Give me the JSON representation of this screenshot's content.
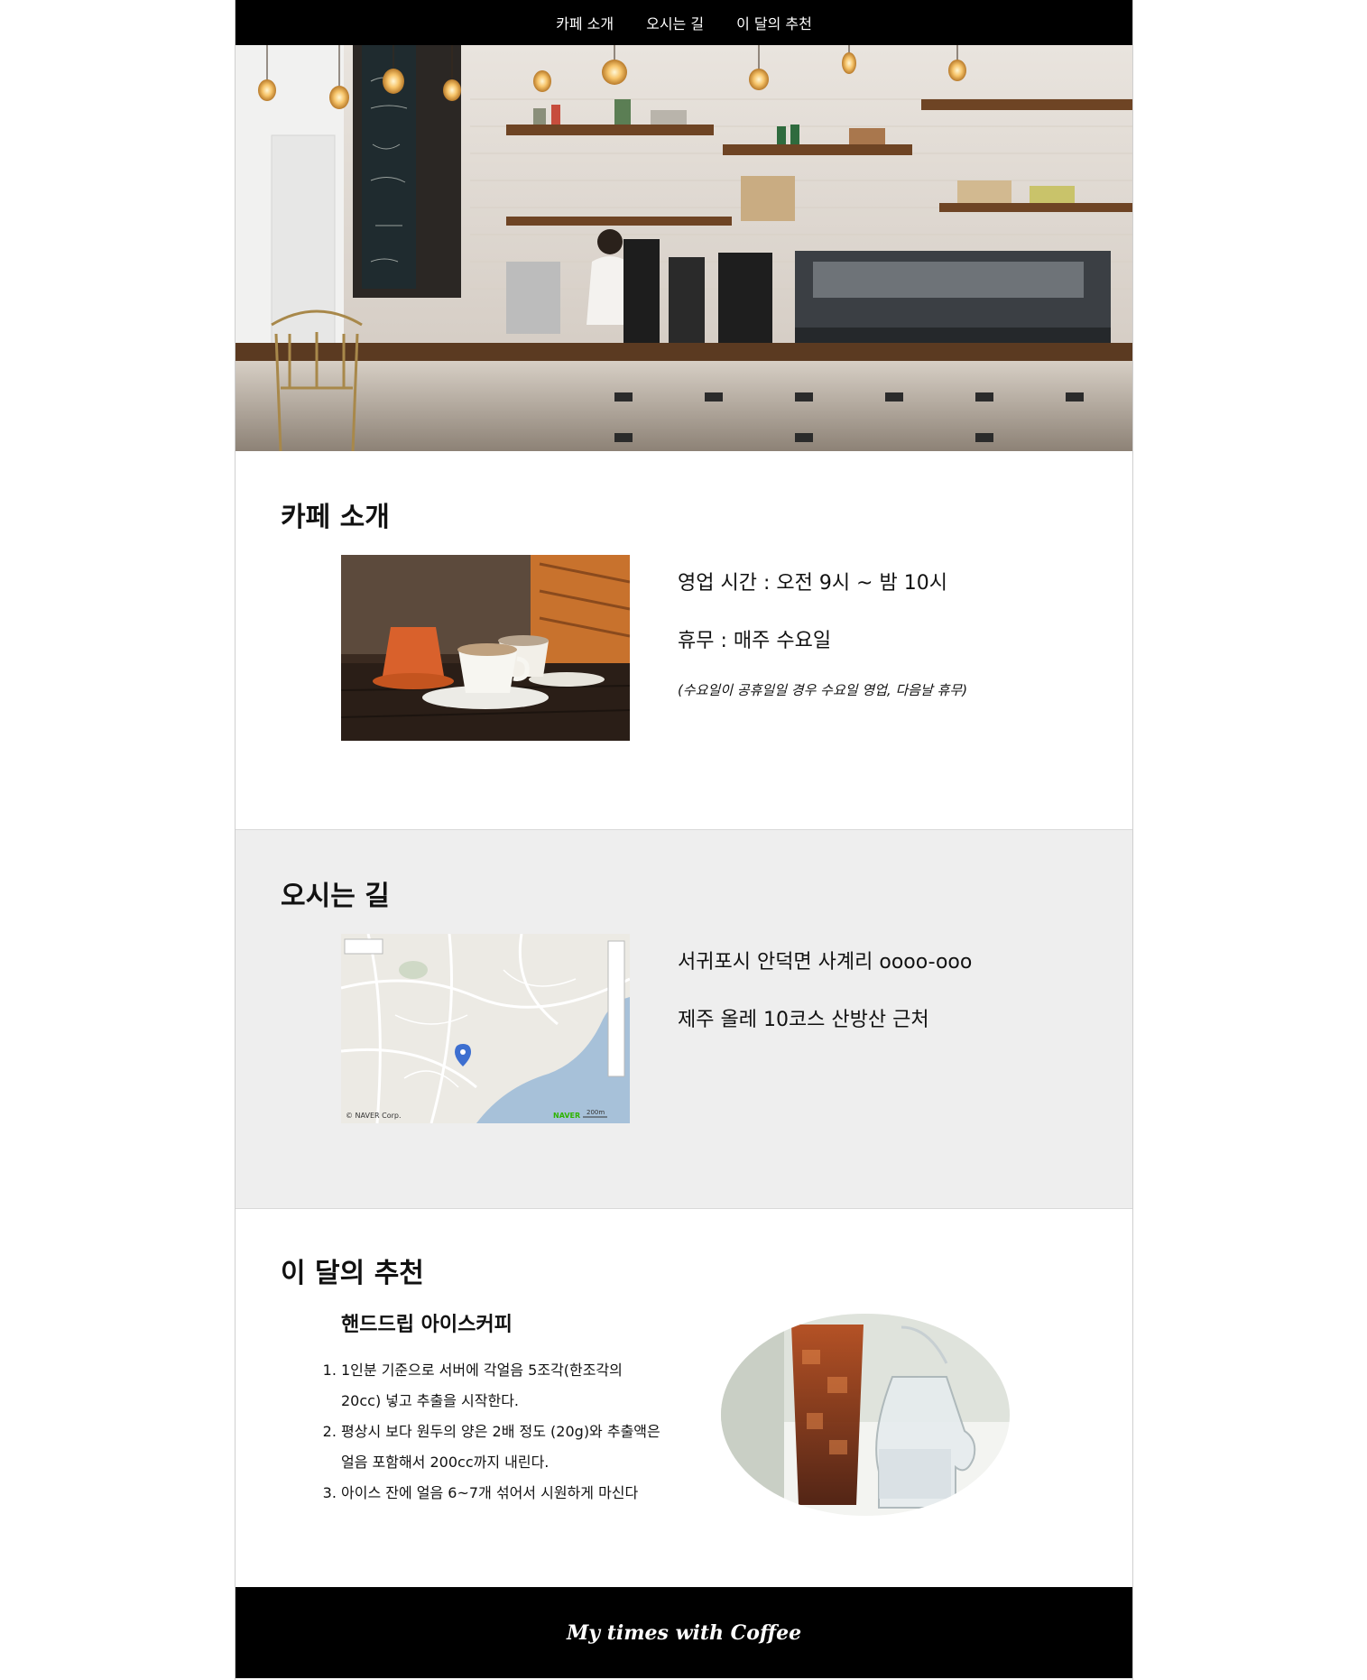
{
  "nav": {
    "items": [
      {
        "label": "카페 소개"
      },
      {
        "label": "오시는 길"
      },
      {
        "label": "이 달의 추천"
      }
    ]
  },
  "intro": {
    "title": "카페 소개",
    "hours": "영업 시간 : 오전 9시 ~ 밤 10시",
    "closed": "휴무 : 매주 수요일",
    "note": "(수요일이 공휴일일 경우 수요일 영업, 다음날 휴무)"
  },
  "directions": {
    "title": "오시는 길",
    "address": "서귀포시 안덕면 사계리 oooo-ooo",
    "landmark": "제주 올레 10코스 산방산 근처",
    "map_copyright": "© NAVER Corp.",
    "map_brand": "NAVER",
    "map_scale": "200m"
  },
  "recommend": {
    "title": "이 달의 추천",
    "recipe_name": "핸드드립 아이스커피",
    "steps": [
      "1인분 기준으로 서버에 각얼음 5조각(한조각의 20cc) 넣고 추출을 시작한다.",
      "평상시 보다 원두의 양은 2배 정도 (20g)와 추출액은 얼음 포함해서 200cc까지 내린다.",
      "아이스 잔에 얼음 6~7개 섞어서 시원하게 마신다"
    ]
  },
  "footer": {
    "text": "My times with Coffee"
  },
  "colors": {
    "nav_bg": "#000000",
    "section_alt_bg": "#eeeeee",
    "footer_bg": "#000000"
  }
}
